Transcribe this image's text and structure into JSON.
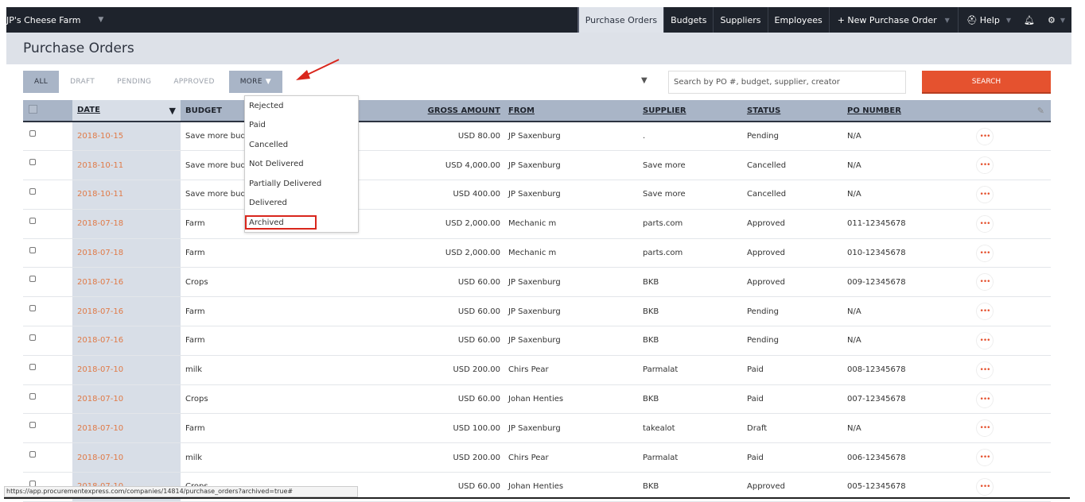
{
  "app": {
    "company": "JP's Cheese Farm",
    "nav": [
      {
        "label": "Purchase Orders",
        "active": true
      },
      {
        "label": "Budgets"
      },
      {
        "label": "Suppliers"
      },
      {
        "label": "Employees"
      },
      {
        "label": "+ New Purchase Order"
      },
      {
        "label": "Help"
      }
    ]
  },
  "page": {
    "title": "Purchase Orders"
  },
  "tabs": {
    "all": "ALL",
    "draft": "DRAFT",
    "pending": "PENDING",
    "approved": "APPROVED",
    "more": "MORE"
  },
  "search": {
    "placeholder": "Search by PO #, budget, supplier, creator",
    "button": "SEARCH"
  },
  "more_menu": {
    "items": [
      "Rejected",
      "Paid",
      "Cancelled",
      "Not Delivered",
      "Partially Delivered",
      "Delivered",
      "Archived"
    ],
    "highlighted": "Archived"
  },
  "table": {
    "headers": {
      "date": "DATE",
      "budget": "BUDGET",
      "gross_amount": "GROSS AMOUNT",
      "from": "FROM",
      "supplier": "SUPPLIER",
      "status": "STATUS",
      "po_number": "PO NUMBER"
    },
    "rows": [
      {
        "date": "2018-10-15",
        "budget": "Save more bud",
        "amount": "USD 80.00",
        "from": "JP Saxenburg",
        "supplier": ".",
        "status": "Pending",
        "po": "N/A"
      },
      {
        "date": "2018-10-11",
        "budget": "Save more bud",
        "amount": "USD 4,000.00",
        "from": "JP Saxenburg",
        "supplier": "Save more",
        "status": "Cancelled",
        "po": "N/A"
      },
      {
        "date": "2018-10-11",
        "budget": "Save more bud",
        "amount": "USD 400.00",
        "from": "JP Saxenburg",
        "supplier": "Save more",
        "status": "Cancelled",
        "po": "N/A"
      },
      {
        "date": "2018-07-18",
        "budget": "Farm",
        "amount": "USD 2,000.00",
        "from": "Mechanic m",
        "supplier": "parts.com",
        "status": "Approved",
        "po": "011-12345678"
      },
      {
        "date": "2018-07-18",
        "budget": "Farm",
        "amount": "USD 2,000.00",
        "from": "Mechanic m",
        "supplier": "parts.com",
        "status": "Approved",
        "po": "010-12345678"
      },
      {
        "date": "2018-07-16",
        "budget": "Crops",
        "amount": "USD 60.00",
        "from": "JP Saxenburg",
        "supplier": "BKB",
        "status": "Approved",
        "po": "009-12345678"
      },
      {
        "date": "2018-07-16",
        "budget": "Farm",
        "amount": "USD 60.00",
        "from": "JP Saxenburg",
        "supplier": "BKB",
        "status": "Pending",
        "po": "N/A"
      },
      {
        "date": "2018-07-16",
        "budget": "Farm",
        "amount": "USD 60.00",
        "from": "JP Saxenburg",
        "supplier": "BKB",
        "status": "Pending",
        "po": "N/A"
      },
      {
        "date": "2018-07-10",
        "budget": "milk",
        "amount": "USD 200.00",
        "from": "Chirs Pear",
        "supplier": "Parmalat",
        "status": "Paid",
        "po": "008-12345678"
      },
      {
        "date": "2018-07-10",
        "budget": "Crops",
        "amount": "USD 60.00",
        "from": "Johan Henties",
        "supplier": "BKB",
        "status": "Paid",
        "po": "007-12345678"
      },
      {
        "date": "2018-07-10",
        "budget": "Farm",
        "amount": "USD 100.00",
        "from": "JP Saxenburg",
        "supplier": "takealot",
        "status": "Draft",
        "po": "N/A"
      },
      {
        "date": "2018-07-10",
        "budget": "milk",
        "amount": "USD 200.00",
        "from": "Chirs Pear",
        "supplier": "Parmalat",
        "status": "Paid",
        "po": "006-12345678"
      },
      {
        "date": "2018-07-10",
        "budget": "Crops",
        "amount": "USD 60.00",
        "from": "Johan Henties",
        "supplier": "BKB",
        "status": "Approved",
        "po": "005-12345678"
      }
    ]
  },
  "status_bar": {
    "url": "https://app.procurementexpress.com/companies/14814/purchase_orders?archived=true#"
  },
  "colors": {
    "accent": "#e5522f",
    "nav_bg": "#1e232c",
    "header_bg": "#a9b5c7",
    "date_text": "#e07a47",
    "highlight_box": "#d9261c"
  }
}
